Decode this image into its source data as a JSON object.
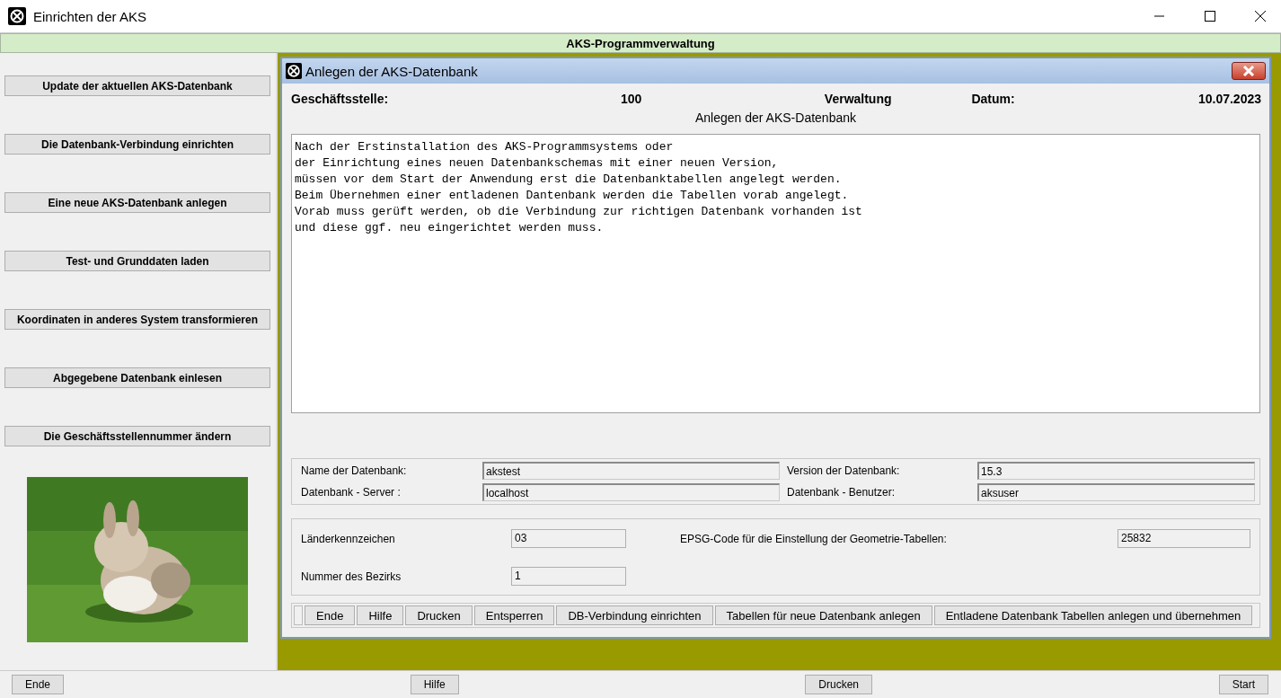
{
  "window": {
    "title": "Einrichten der AKS"
  },
  "header": {
    "title": "AKS-Programmverwaltung"
  },
  "sidebar": {
    "buttons": [
      "Update der aktuellen AKS-Datenbank",
      "Die Datenbank-Verbindung einrichten",
      "Eine neue AKS-Datenbank anlegen",
      "Test- und Grunddaten laden",
      "Koordinaten in anderes System transformieren",
      "Abgegebene Datenbank einlesen",
      "Die Geschäftsstellennummer ändern"
    ]
  },
  "dialog": {
    "title": "Anlegen der AKS-Datenbank",
    "info": [
      {
        "kind": "label",
        "text": "Geschäftsstelle:"
      },
      {
        "kind": "value",
        "text": "100"
      },
      {
        "kind": "value",
        "text": "Verwaltung"
      },
      {
        "kind": "label",
        "text": "Datum:"
      },
      {
        "kind": "date",
        "text": "10.07.2023"
      }
    ],
    "subtitle": "Anlegen der AKS-Datenbank",
    "description": [
      "Nach der Erstinstallation des AKS-Programmsystems oder",
      "der Einrichtung eines neuen Datenbankschemas mit einer neuen Version,",
      "müssen vor dem Start der Anwendung erst die Datenbanktabellen angelegt werden.",
      "Beim Übernehmen einer entladenen Dantenbank werden die Tabellen vorab angelegt.",
      "Vorab muss gerüft werden, ob die Verbindung zur richtigen Datenbank vorhanden ist",
      "und diese ggf. neu eingerichtet werden muss."
    ],
    "connection_fields": [
      {
        "label": "Name der Datenbank:",
        "value": "akstest"
      },
      {
        "label": "Version der Datenbank:",
        "value": "15.3"
      },
      {
        "label": "Datenbank - Server :",
        "value": "localhost"
      },
      {
        "label": "Datenbank - Benutzer:",
        "value": "aksuser"
      }
    ],
    "settings": [
      {
        "label": "Länderkennzeichen",
        "value": "03"
      },
      {
        "label": "EPSG-Code für die Einstellung der Geometrie-Tabellen:",
        "value": "25832"
      },
      {
        "label": "Nummer des Bezirks",
        "value": "1"
      }
    ],
    "buttons": [
      "Ende",
      "Hilfe",
      "Drucken",
      "Entsperren",
      "DB-Verbindung einrichten",
      "Tabellen für neue Datenbank anlegen",
      "Entladene Datenbank Tabellen anlegen und übernehmen"
    ]
  },
  "bottom_bar": {
    "buttons": [
      "Ende",
      "Hilfe",
      "Drucken",
      "Start"
    ]
  }
}
